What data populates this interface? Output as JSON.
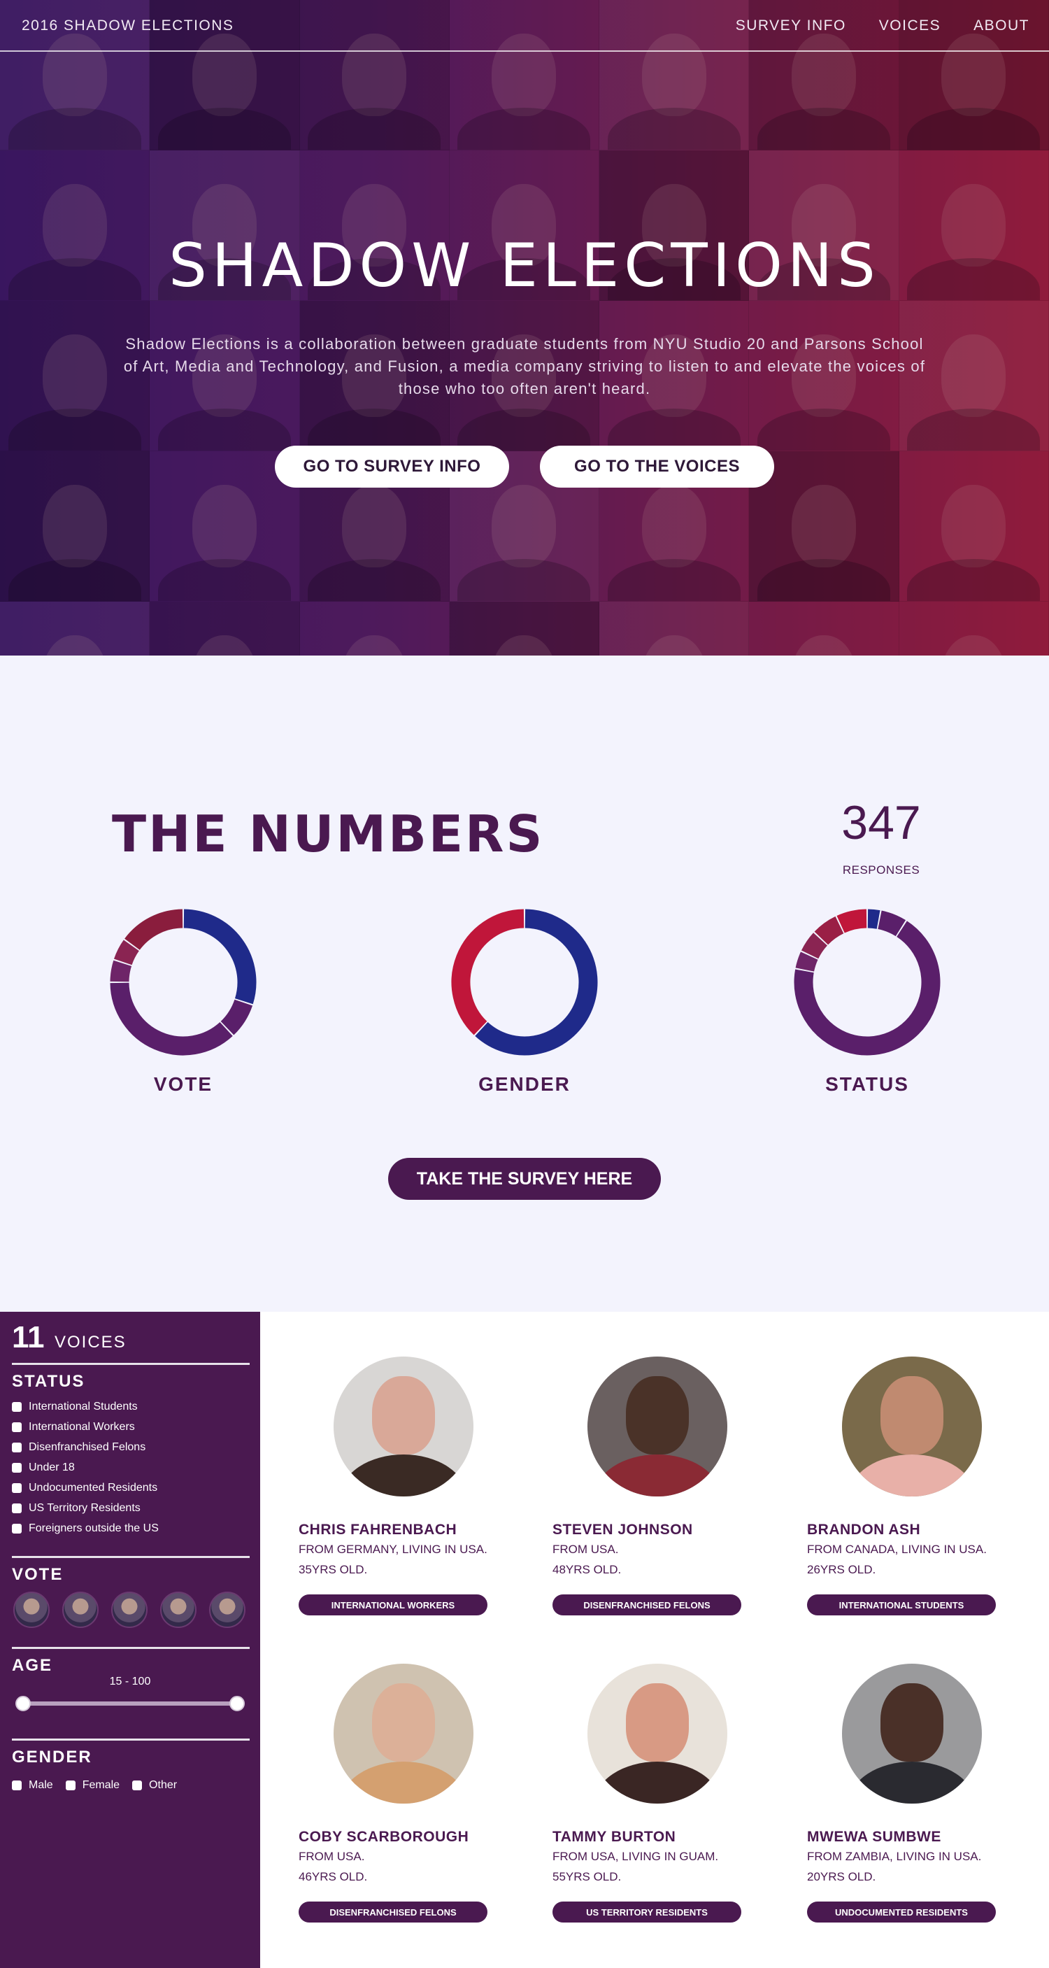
{
  "nav": {
    "brand": "2016 SHADOW ELECTIONS",
    "links": [
      "SURVEY INFO",
      "VOICES",
      "ABOUT"
    ]
  },
  "hero": {
    "title": "SHADOW ELECTIONS",
    "description": "Shadow Elections is a collaboration between graduate students from NYU Studio 20 and Parsons School of Art, Media and Technology, and Fusion, a media company striving to listen to and elevate the voices of those who too often aren't heard.",
    "buttons": [
      "GO TO SURVEY INFO",
      "GO TO THE VOICES"
    ]
  },
  "numbers": {
    "title": "THE NUMBERS",
    "responses_count": "347",
    "responses_label": "RESPONSES",
    "survey_button": "TAKE THE SURVEY HERE"
  },
  "chart_data": [
    {
      "type": "pie",
      "label": "VOTE",
      "values": [
        30,
        8,
        37,
        5,
        5,
        15
      ],
      "colors": [
        "#1f2a8a",
        "#5a1f6a",
        "#5a1f6a",
        "#6e2568",
        "#8a2452",
        "#8a1d3d"
      ]
    },
    {
      "type": "pie",
      "label": "GENDER",
      "values": [
        62,
        38
      ],
      "colors": [
        "#1f2a8a",
        "#c0163a"
      ]
    },
    {
      "type": "pie",
      "label": "STATUS",
      "values": [
        3,
        6,
        69,
        4,
        5,
        6,
        7
      ],
      "colors": [
        "#1f2a8a",
        "#5a1f6a",
        "#5a1f6a",
        "#6e2568",
        "#8a2452",
        "#9a1f45",
        "#c0163a"
      ]
    }
  ],
  "voices_filter": {
    "count": "11",
    "count_label": "VOICES",
    "status_heading": "STATUS",
    "status_options": [
      "International Students",
      "International Workers",
      "Disenfranchised Felons",
      "Under 18",
      "Undocumented Residents",
      "US Territory Residents",
      "Foreigners outside the US"
    ],
    "vote_heading": "VOTE",
    "age_heading": "AGE",
    "age_range": "15 - 100",
    "age_min_fraction": 0.0,
    "age_max_fraction": 1.0,
    "gender_heading": "GENDER",
    "gender_options": [
      "Male",
      "Female",
      "Other"
    ]
  },
  "voices": [
    {
      "name": "CHRIS FAHRENBACH",
      "from": "FROM GERMANY, LIVING IN USA.",
      "age": "35YRS OLD.",
      "tag": "INTERNATIONAL WORKERS"
    },
    {
      "name": "STEVEN JOHNSON",
      "from": "FROM USA.",
      "age": "48YRS OLD.",
      "tag": "DISENFRANCHISED FELONS"
    },
    {
      "name": "BRANDON ASH",
      "from": "FROM CANADA, LIVING IN USA.",
      "age": "26YRS OLD.",
      "tag": "INTERNATIONAL STUDENTS"
    },
    {
      "name": "COBY SCARBOROUGH",
      "from": "FROM USA.",
      "age": "46YRS OLD.",
      "tag": "DISENFRANCHISED FELONS"
    },
    {
      "name": "TAMMY BURTON",
      "from": "FROM USA, LIVING IN GUAM.",
      "age": "55YRS OLD.",
      "tag": "US TERRITORY RESIDENTS"
    },
    {
      "name": "MWEWA SUMBWE",
      "from": "FROM ZAMBIA, LIVING IN USA.",
      "age": "20YRS OLD.",
      "tag": "UNDOCUMENTED RESIDENTS"
    }
  ]
}
